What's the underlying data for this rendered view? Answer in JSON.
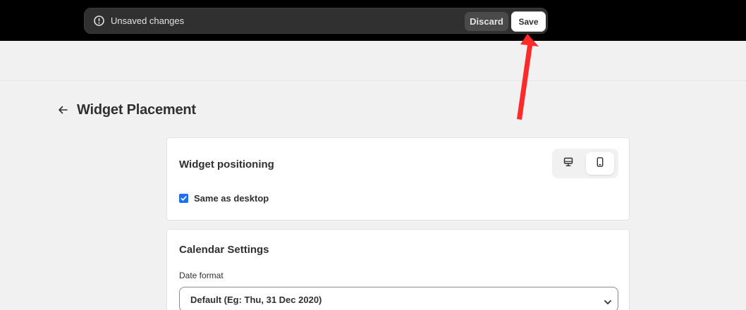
{
  "savebar": {
    "message": "Unsaved changes",
    "discard_label": "Discard",
    "save_label": "Save"
  },
  "page": {
    "title": "Widget Placement"
  },
  "positioning_card": {
    "title": "Widget positioning",
    "checkbox_label": "Same as desktop",
    "checkbox_checked": true,
    "device_selected": "mobile"
  },
  "calendar_card": {
    "title": "Calendar Settings",
    "date_format_label": "Date format",
    "date_format_value": "Default (Eg: Thu, 31 Dec 2020)"
  },
  "colors": {
    "accent": "#1f6ff0",
    "annotation_arrow": "#ff2a2a"
  }
}
